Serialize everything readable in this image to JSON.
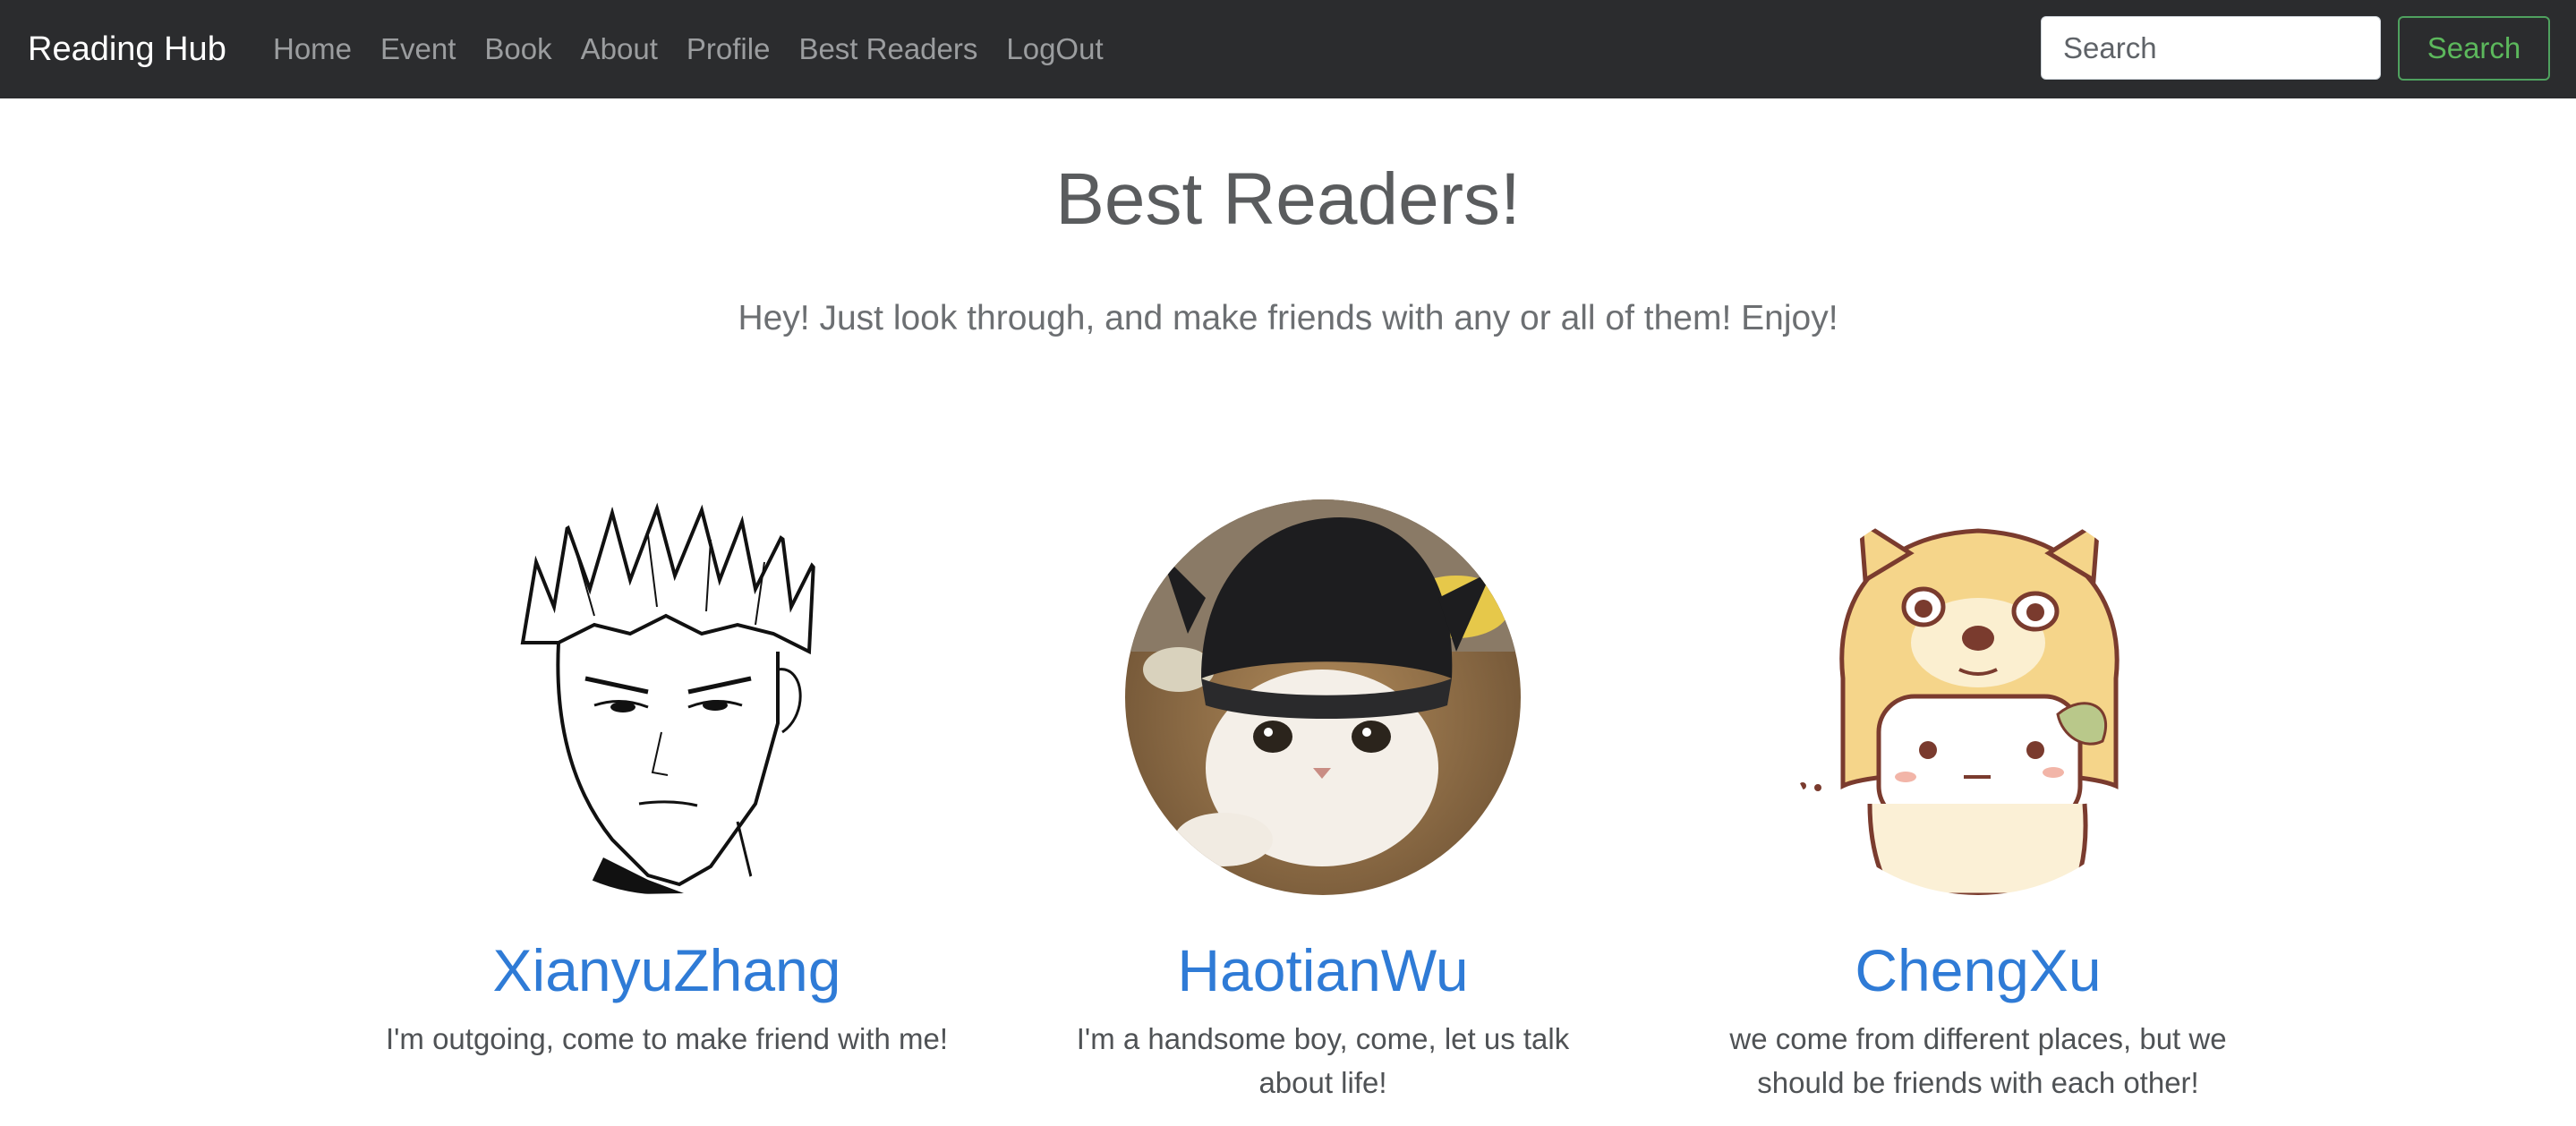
{
  "navbar": {
    "brand": "Reading Hub",
    "links": [
      "Home",
      "Event",
      "Book",
      "About",
      "Profile",
      "Best Readers",
      "LogOut"
    ],
    "search_placeholder": "Search",
    "search_button": "Search"
  },
  "page": {
    "title": "Best Readers!",
    "subtitle": "Hey! Just look through, and make friends with any or all of them! Enjoy!"
  },
  "readers": [
    {
      "name": "XianyuZhang",
      "description": "I'm outgoing, come to make friend with me!",
      "avatar": "sketch-boy-avatar"
    },
    {
      "name": "HaotianWu",
      "description": "I'm a handsome boy, come, let us talk about life!",
      "avatar": "cat-in-hat-avatar"
    },
    {
      "name": "ChengXu",
      "description": "we come from different places, but we should be friends with each other!",
      "avatar": "shiba-costume-avatar"
    }
  ],
  "colors": {
    "navbar_bg": "#2b2c2e",
    "link": "#2f7bd6",
    "search_button": "#5cb85c"
  }
}
